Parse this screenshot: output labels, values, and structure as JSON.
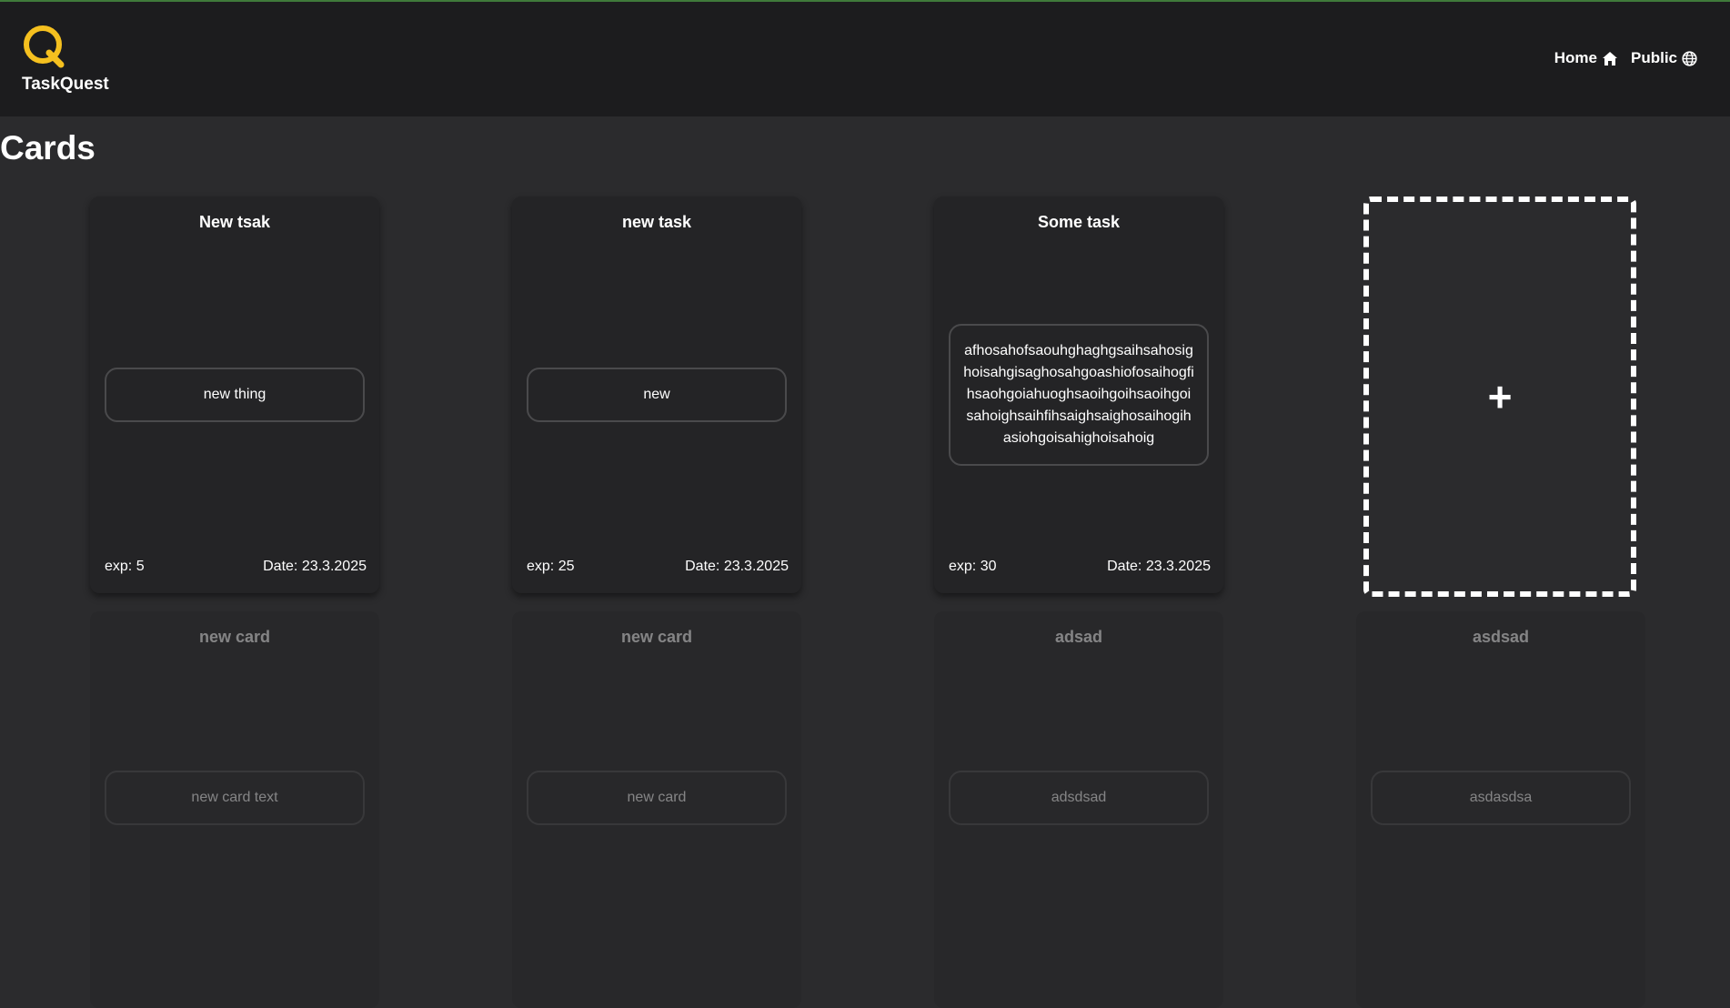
{
  "app": {
    "name": "TaskQuest",
    "logo_letter": "Q",
    "accent_color": "#f5c01f"
  },
  "nav": [
    {
      "label": "Home",
      "icon": "home-icon"
    },
    {
      "label": "Public",
      "icon": "globe-icon"
    }
  ],
  "page": {
    "title": "Cards"
  },
  "cards": [
    {
      "title": "New tsak",
      "body": "new thing",
      "exp": "exp: 5",
      "date": "Date: 23.3.2025"
    },
    {
      "title": "new task",
      "body": "new",
      "exp": "exp: 25",
      "date": "Date: 23.3.2025"
    },
    {
      "title": "Some task",
      "body": "afhosahofsaouhghaghgsaihsahosighoisahgisaghosahgoashiofosaihogfihsaohgoiahuoghsaoihgoihsaoihgoisahoighsaihfihsaighsaighosaihogihasiohgoisahighoisahoig",
      "exp": "exp: 30",
      "date": "Date: 23.3.2025"
    }
  ],
  "add_card": {
    "symbol": "+"
  },
  "faded_cards": [
    {
      "title": "new card",
      "body": "new card text"
    },
    {
      "title": "new card",
      "body": "new card"
    },
    {
      "title": "adsad",
      "body": "adsdsad"
    },
    {
      "title": "asdsad",
      "body": "asdasdsa"
    }
  ]
}
